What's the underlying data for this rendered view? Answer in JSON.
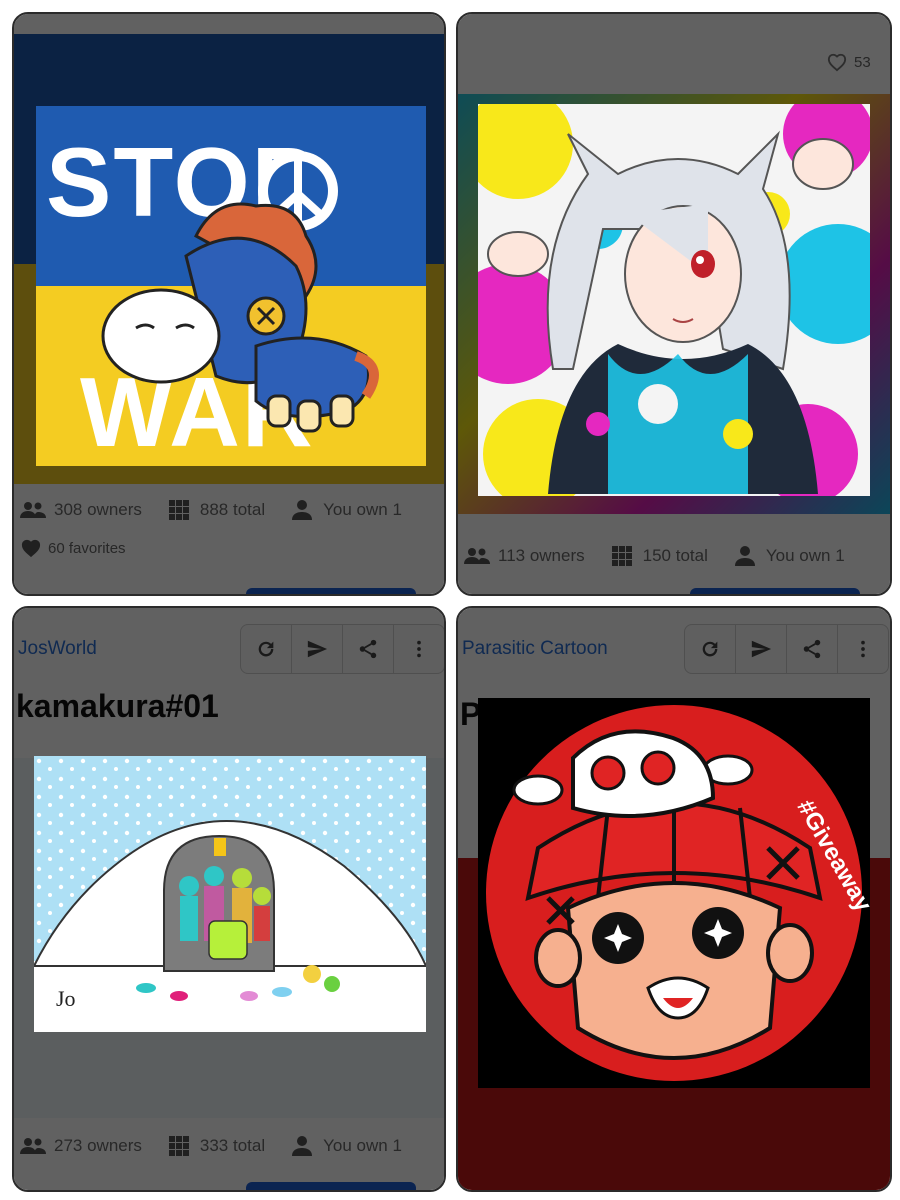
{
  "cards": [
    {
      "artwork": {
        "top_text": "STOP",
        "bottom_text": "WAR"
      },
      "stats": {
        "owners": "308 owners",
        "total": "888 total",
        "you_own": "You own 1"
      },
      "favorites": "60 favorites"
    },
    {
      "favorites_count": "53",
      "stats": {
        "owners": "113 owners",
        "total": "150 total",
        "you_own": "You own 1"
      }
    },
    {
      "creator": "JosWorld",
      "title": "kamakura#01",
      "artwork": {
        "signature": "Jo"
      },
      "stats": {
        "owners": "273 owners",
        "total": "333 total",
        "you_own": "You own 1"
      }
    },
    {
      "creator": "Parasitic Cartoon",
      "title": "Parasitic Cartoon #",
      "artwork": {
        "tag": "#Giveaway"
      }
    }
  ],
  "colors": {
    "ukraine_blue": "#1f5bb0",
    "ukraine_yellow": "#f4cc22",
    "creator_link": "#2a6fd6",
    "cartoon_red": "#d81e1e",
    "snow_sky": "#aee0f5"
  }
}
